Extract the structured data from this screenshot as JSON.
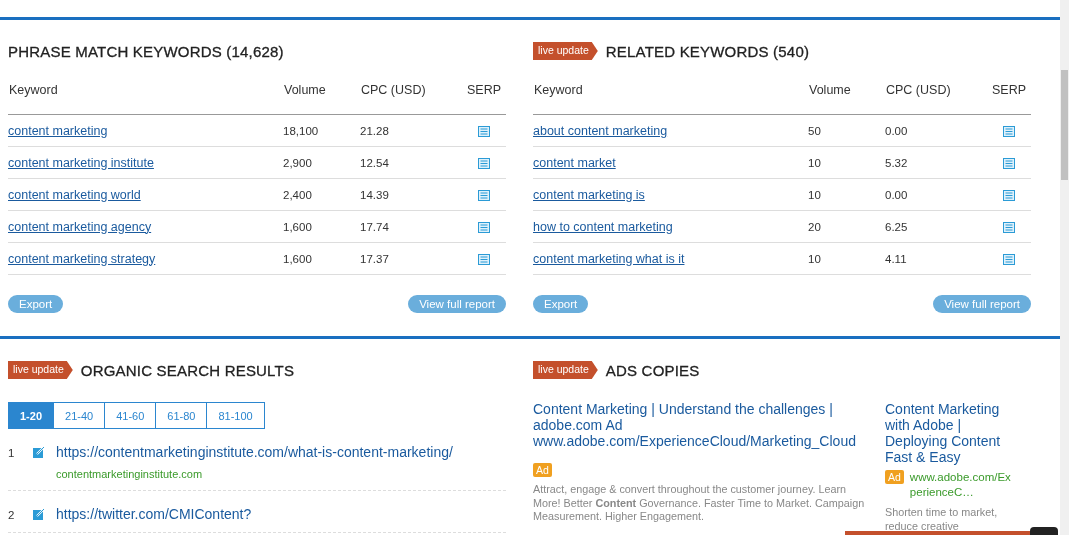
{
  "keyword_panels": [
    {
      "title": "PHRASE MATCH KEYWORDS (14,628)",
      "columns": [
        "Keyword",
        "Volume",
        "CPC (USD)",
        "SERP"
      ],
      "rows": [
        {
          "keyword": "content marketing",
          "volume": "18,100",
          "cpc": "21.28"
        },
        {
          "keyword": "content marketing institute",
          "volume": "2,900",
          "cpc": "12.54"
        },
        {
          "keyword": "content marketing world",
          "volume": "2,400",
          "cpc": "14.39"
        },
        {
          "keyword": "content marketing agency",
          "volume": "1,600",
          "cpc": "17.74"
        },
        {
          "keyword": "content marketing strategy",
          "volume": "1,600",
          "cpc": "17.37"
        }
      ],
      "buttons": [
        "Export",
        "View full report"
      ]
    },
    {
      "badge": "live update",
      "title": "RELATED KEYWORDS (540)",
      "columns": [
        "Keyword",
        "Volume",
        "CPC (USD)",
        "SERP"
      ],
      "rows": [
        {
          "keyword": "about content marketing",
          "volume": "50",
          "cpc": "0.00"
        },
        {
          "keyword": "content market",
          "volume": "10",
          "cpc": "5.32"
        },
        {
          "keyword": "content marketing is",
          "volume": "10",
          "cpc": "0.00"
        },
        {
          "keyword": "how to content marketing",
          "volume": "20",
          "cpc": "6.25"
        },
        {
          "keyword": "content marketing what is it",
          "volume": "10",
          "cpc": "4.11"
        }
      ],
      "buttons": [
        "Export",
        "View full report"
      ]
    }
  ],
  "organic": {
    "badge": "live update",
    "title": "ORGANIC SEARCH RESULTS",
    "pages": [
      {
        "label": "1-20",
        "selected": true
      },
      {
        "label": "21-40",
        "selected": false
      },
      {
        "label": "41-60",
        "selected": false
      },
      {
        "label": "61-80",
        "selected": false
      },
      {
        "label": "81-100",
        "selected": false
      }
    ],
    "results": [
      {
        "rank": "1",
        "url": "https://contentmarketinginstitute.com/what-is-content-marketing/",
        "domain": "contentmarketinginstitute.com"
      },
      {
        "rank": "2",
        "url": "https://twitter.com/CMIContent?"
      }
    ]
  },
  "ads": {
    "badge": "live update",
    "title": "ADS COPIES",
    "items": [
      {
        "kind": "wide",
        "title": "Content Marketing | Understand the challenges | adobe.com Ad",
        "url": "www.adobe.com/ExperienceCloud/Marketing_Cloud",
        "label": "Ad",
        "description": "Attract, engage & convert throughout the customer journey. Learn More! Better **Content** Governance. Faster Time to Market. Campaign Measurement. Higher Engagement."
      },
      {
        "kind": "narrow",
        "title": "Content Marketing with Adobe | Deploying Content Fast & Easy",
        "url": "www.adobe.com/ExperienceC…",
        "label": "Ad",
        "description": "Shorten time to market, reduce creative"
      }
    ]
  }
}
